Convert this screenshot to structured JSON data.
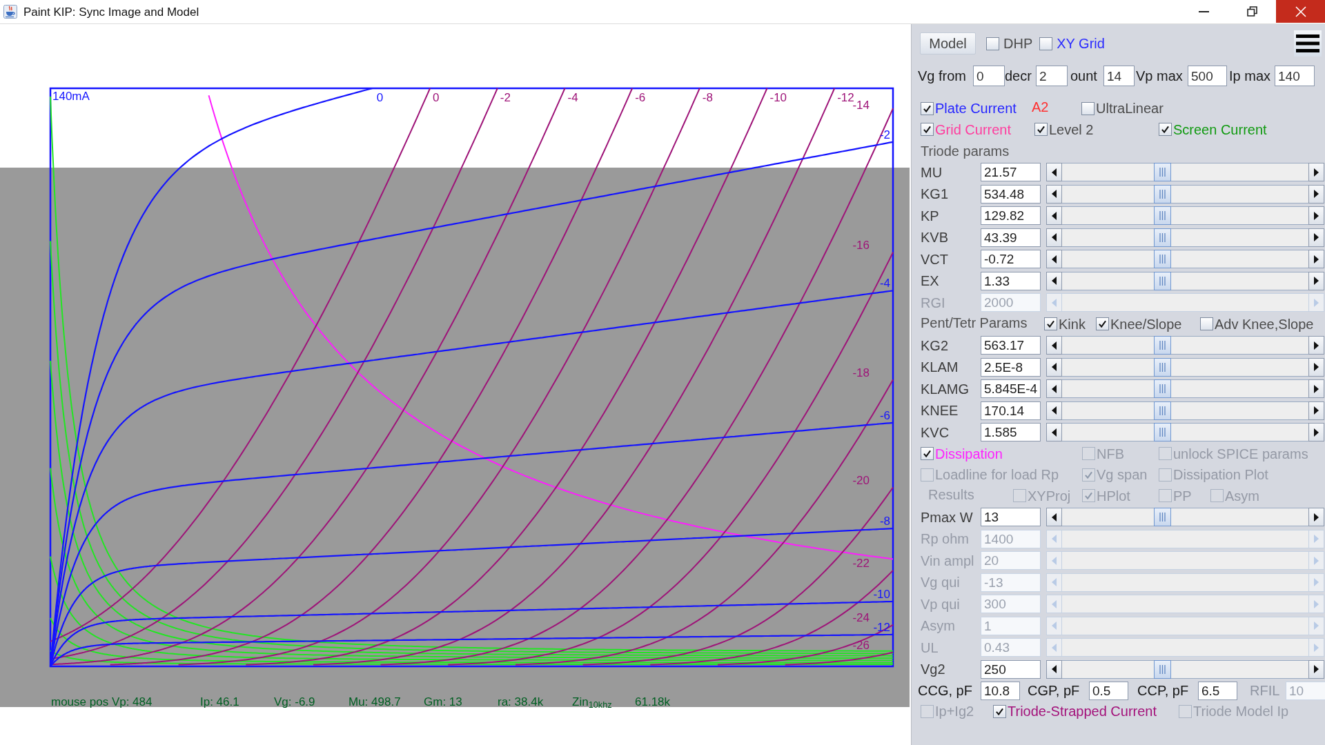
{
  "window": {
    "title": "Paint KIP: Sync Image and Model"
  },
  "canvas": {
    "axis_max_label": "140mA",
    "plate_curves": [
      {
        "label": "0"
      },
      {
        "label": "-2"
      },
      {
        "label": "-4"
      },
      {
        "label": "-6"
      },
      {
        "label": "-8"
      },
      {
        "label": "-10"
      },
      {
        "label": "-12"
      }
    ],
    "triode_curves": [
      {
        "label": "0"
      },
      {
        "label": "-2"
      },
      {
        "label": "-4"
      },
      {
        "label": "-6"
      },
      {
        "label": "-8"
      },
      {
        "label": "-10"
      },
      {
        "label": "-12"
      },
      {
        "label": "-14"
      },
      {
        "label": "-16"
      },
      {
        "label": "-18"
      },
      {
        "label": "-20"
      },
      {
        "label": "-22"
      },
      {
        "label": "-24"
      },
      {
        "label": "-26"
      }
    ],
    "status": [
      "mouse pos Vp: 484",
      "Ip: 46.1",
      "Vg: -6.9",
      "Mu: 498.7",
      "Gm: 13",
      "ra: 38.4k",
      "Zin$_{10khz}$",
      "61.18k"
    ]
  },
  "panel": {
    "model_button": "Model",
    "top_checks": [
      {
        "label": "DHP",
        "checked": false
      },
      {
        "label": "XY Grid",
        "checked": false,
        "color": "#2a2aff"
      }
    ],
    "range_fields": [
      {
        "label": "Vg from",
        "value": "0"
      },
      {
        "label": "decr",
        "value": "2"
      },
      {
        "label": "ount",
        "value": "14"
      },
      {
        "label": "Vp max",
        "value": "500"
      },
      {
        "label": "Ip max",
        "value": "140"
      }
    ],
    "rows": [
      {
        "kind": "checks",
        "items": [
          {
            "kind": "checkbox",
            "label": "Plate Current",
            "checked": true,
            "disabled": false,
            "color": "#2525ff"
          },
          {
            "kind": "text",
            "label": "A2",
            "color": "#ff3030"
          },
          {
            "kind": "checkbox",
            "label": "UltraLinear",
            "checked": false,
            "disabled": false
          }
        ]
      },
      {
        "kind": "checks",
        "items": [
          {
            "kind": "checkbox",
            "label": "Grid Current",
            "checked": true,
            "disabled": false,
            "color": "#ff3d9e"
          },
          {
            "kind": "checkbox",
            "label": "Level 2",
            "checked": true,
            "disabled": false
          },
          {
            "kind": "checkbox",
            "label": "Screen Current",
            "checked": true,
            "disabled": false,
            "color": "#109a10"
          }
        ]
      },
      {
        "kind": "heading",
        "label": "Triode params"
      },
      {
        "kind": "param",
        "label": "MU",
        "value": "21.57",
        "disabled": false,
        "level": 0.4
      },
      {
        "kind": "param",
        "label": "KG1",
        "value": "534.48",
        "disabled": false,
        "level": 0.4
      },
      {
        "kind": "param",
        "label": "KP",
        "value": "129.82",
        "disabled": false,
        "level": 0.4
      },
      {
        "kind": "param",
        "label": "KVB",
        "value": "43.39",
        "disabled": false,
        "level": 0.4
      },
      {
        "kind": "param",
        "label": "VCT",
        "value": "-0.72",
        "disabled": false,
        "level": 0.4
      },
      {
        "kind": "param",
        "label": "EX",
        "value": "1.33",
        "disabled": false,
        "level": 0.4
      },
      {
        "kind": "param",
        "label": "RGI",
        "value": "2000",
        "disabled": true
      },
      {
        "kind": "checks",
        "items": [
          {
            "kind": "text",
            "label": "Pent/Tetr Params",
            "disabled": false
          },
          {
            "kind": "checkbox",
            "label": "Kink",
            "checked": true,
            "disabled": false
          },
          {
            "kind": "checkbox",
            "label": "Knee/Slope",
            "checked": true,
            "disabled": false
          },
          {
            "kind": "checkbox",
            "label": "Adv Knee,Slope",
            "checked": false,
            "disabled": false
          }
        ]
      },
      {
        "kind": "param",
        "label": "KG2",
        "value": "563.17",
        "disabled": false,
        "level": 0.4
      },
      {
        "kind": "param",
        "label": "KLAM",
        "value": "2.5E-8",
        "disabled": false,
        "level": 0.4
      },
      {
        "kind": "param",
        "label": "KLAMG",
        "value": "5.845E-4",
        "disabled": false,
        "level": 0.4
      },
      {
        "kind": "param",
        "label": "KNEE",
        "value": "170.14",
        "disabled": false,
        "level": 0.4
      },
      {
        "kind": "param",
        "label": "KVC",
        "value": "1.585",
        "disabled": false,
        "level": 0.4
      },
      {
        "kind": "checks",
        "items": [
          {
            "kind": "checkbox",
            "label": "Dissipation",
            "checked": true,
            "disabled": false,
            "color": "#ff22ff"
          },
          {
            "kind": "checkbox",
            "label": "NFB",
            "checked": false,
            "disabled": true
          },
          {
            "kind": "checkbox",
            "label": "unlock SPICE params",
            "checked": false,
            "disabled": true
          }
        ]
      },
      {
        "kind": "checks",
        "items": [
          {
            "kind": "checkbox",
            "label": "Loadline for load Rp",
            "checked": false,
            "disabled": true
          },
          {
            "kind": "checkbox",
            "label": "Vg span",
            "checked": true,
            "disabled": true
          },
          {
            "kind": "checkbox",
            "label": "Dissipation Plot",
            "checked": false,
            "disabled": true
          }
        ]
      },
      {
        "kind": "checks",
        "items": [
          {
            "kind": "text",
            "label": "Results",
            "disabled": true
          },
          {
            "kind": "checkbox",
            "label": "XYProj",
            "checked": false,
            "disabled": true
          },
          {
            "kind": "checkbox",
            "label": "HPlot",
            "checked": true,
            "disabled": true
          },
          {
            "kind": "checkbox",
            "label": "PP",
            "checked": false,
            "disabled": true
          },
          {
            "kind": "checkbox",
            "label": "Asym",
            "checked": false,
            "disabled": true
          }
        ]
      },
      {
        "kind": "param",
        "label": "Pmax W",
        "value": "13",
        "disabled": false,
        "level": 0.4
      },
      {
        "kind": "param",
        "label": "Rp ohm",
        "value": "1400",
        "disabled": true
      },
      {
        "kind": "param",
        "label": "Vin ampl",
        "value": "20",
        "disabled": true
      },
      {
        "kind": "param",
        "label": "Vg qui",
        "value": "-13",
        "disabled": true
      },
      {
        "kind": "param",
        "label": "Vp qui",
        "value": "300",
        "disabled": true
      },
      {
        "kind": "param",
        "label": "Asym",
        "value": "1",
        "disabled": true
      },
      {
        "kind": "param",
        "label": "UL",
        "value": "0.43",
        "disabled": true
      },
      {
        "kind": "param",
        "label": "Vg2",
        "value": "250",
        "disabled": false,
        "level": 0.4
      },
      {
        "kind": "fields",
        "items": [
          {
            "label": "CCG, pF",
            "value": "10.8",
            "disabled": false
          },
          {
            "label": "CGP, pF",
            "value": "0.5",
            "disabled": false
          },
          {
            "label": "CCP, pF",
            "value": "6.5",
            "disabled": false
          },
          {
            "label": "RFIL",
            "value": "10",
            "disabled": true
          }
        ]
      },
      {
        "kind": "checks",
        "items": [
          {
            "kind": "checkbox",
            "label": "Ip+Ig2",
            "checked": false,
            "disabled": true
          },
          {
            "kind": "checkbox",
            "label": "Triode-Strapped Current",
            "checked": true,
            "disabled": false,
            "color": "#a3117a"
          },
          {
            "kind": "checkbox",
            "label": "Triode Model Ip",
            "checked": false,
            "disabled": true
          }
        ]
      }
    ]
  }
}
